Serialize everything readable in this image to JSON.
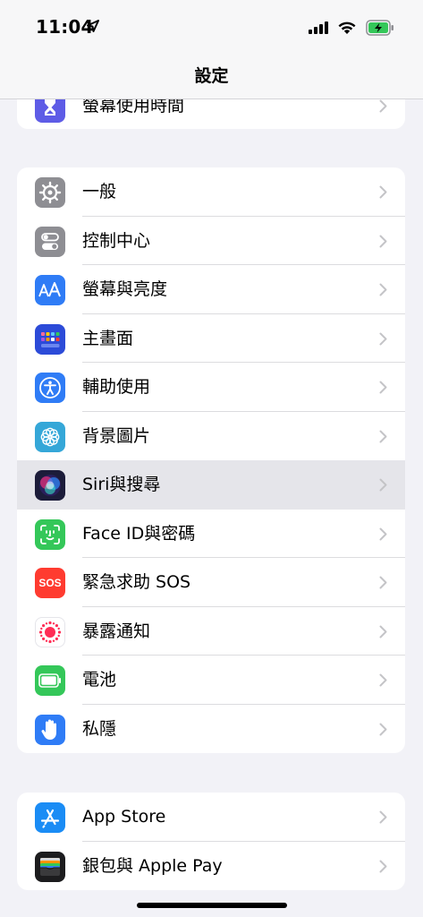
{
  "status": {
    "time": "11:04"
  },
  "nav": {
    "title": "設定"
  },
  "group1": [
    {
      "label": "螢幕使用時間",
      "icon": "hourglass-icon",
      "color": "#5e5ce6"
    }
  ],
  "group2": [
    {
      "label": "一般",
      "icon": "gear-icon",
      "color": "#8e8e93"
    },
    {
      "label": "控制中心",
      "icon": "toggles-icon",
      "color": "#8e8e93"
    },
    {
      "label": "螢幕與亮度",
      "icon": "text-size-icon",
      "color": "#2f7cf6"
    },
    {
      "label": "主畫面",
      "icon": "app-grid-icon",
      "color": "#2c4bd8"
    },
    {
      "label": "輔助使用",
      "icon": "accessibility-icon",
      "color": "#2f7cf6"
    },
    {
      "label": "背景圖片",
      "icon": "flower-icon",
      "color": "#35a7d8"
    },
    {
      "label": "Siri與搜尋",
      "icon": "siri-icon",
      "color": "#1c1c3a",
      "selected": true
    },
    {
      "label": "Face ID與密碼",
      "icon": "face-id-icon",
      "color": "#34c759"
    },
    {
      "label": "緊急求助 SOS",
      "icon": "sos-icon",
      "color": "#ff3b30",
      "icon_text": "SOS"
    },
    {
      "label": "暴露通知",
      "icon": "exposure-icon",
      "color": "#ffffff"
    },
    {
      "label": "電池",
      "icon": "battery-icon",
      "color": "#34c759"
    },
    {
      "label": "私隱",
      "icon": "hand-icon",
      "color": "#2f7cf6"
    }
  ],
  "group3": [
    {
      "label": "App Store",
      "icon": "app-store-icon",
      "color": "#1a8cf5"
    },
    {
      "label": "銀包與 Apple Pay",
      "icon": "wallet-icon",
      "color": "#1c1c1e"
    }
  ]
}
